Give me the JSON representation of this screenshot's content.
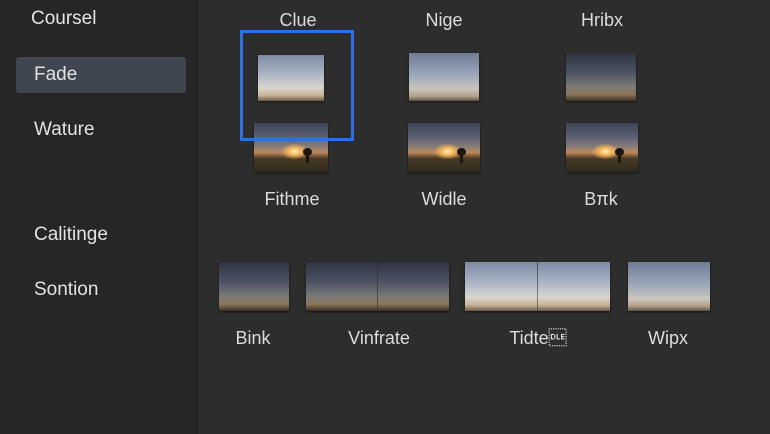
{
  "sidebar": {
    "heading": "Coursel",
    "items": [
      {
        "label": "Fade",
        "selected": true
      },
      {
        "label": "Wature",
        "selected": false
      },
      {
        "label": "Calitinge",
        "selected": false
      },
      {
        "label": "Sontion",
        "selected": false
      }
    ]
  },
  "gallery": {
    "column_headers": [
      "Clue",
      "Nige",
      "Hribx"
    ],
    "row_labels": [
      "Fithme",
      "Widle",
      "Bπk"
    ],
    "selected_item": "Clue"
  },
  "strip": {
    "labels": [
      "Bink",
      "Vinfrate",
      "Tidte\u0010",
      "Wipx"
    ]
  },
  "colors": {
    "selection_border": "#2f6fe4",
    "sidebar_selected_bg": "#3f4650",
    "background": "#2c2c2c"
  }
}
